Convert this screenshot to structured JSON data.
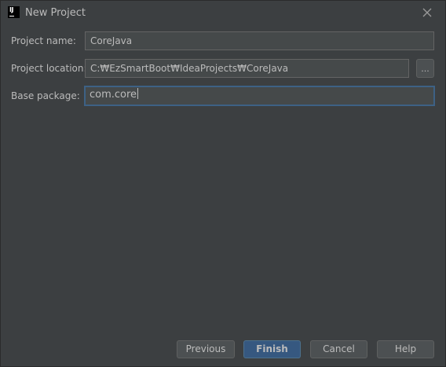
{
  "window": {
    "title": "New Project",
    "icon": "intellij-idea-icon",
    "icon_text": "IJ"
  },
  "form": {
    "project_name": {
      "label": "Project name:",
      "value": "CoreJava"
    },
    "project_location": {
      "label": "Project location:",
      "value": "C:₩EzSmartBoot₩IdeaProjects₩CoreJava",
      "browse_label": "..."
    },
    "base_package": {
      "label": "Base package:",
      "value": "com.core"
    }
  },
  "buttons": {
    "previous": "Previous",
    "finish": "Finish",
    "cancel": "Cancel",
    "help": "Help"
  },
  "colors": {
    "background": "#3c3f41",
    "field_background": "#45494a",
    "focus_border": "#3d6185",
    "default_button": "#365880",
    "text": "#bbbbbb"
  }
}
